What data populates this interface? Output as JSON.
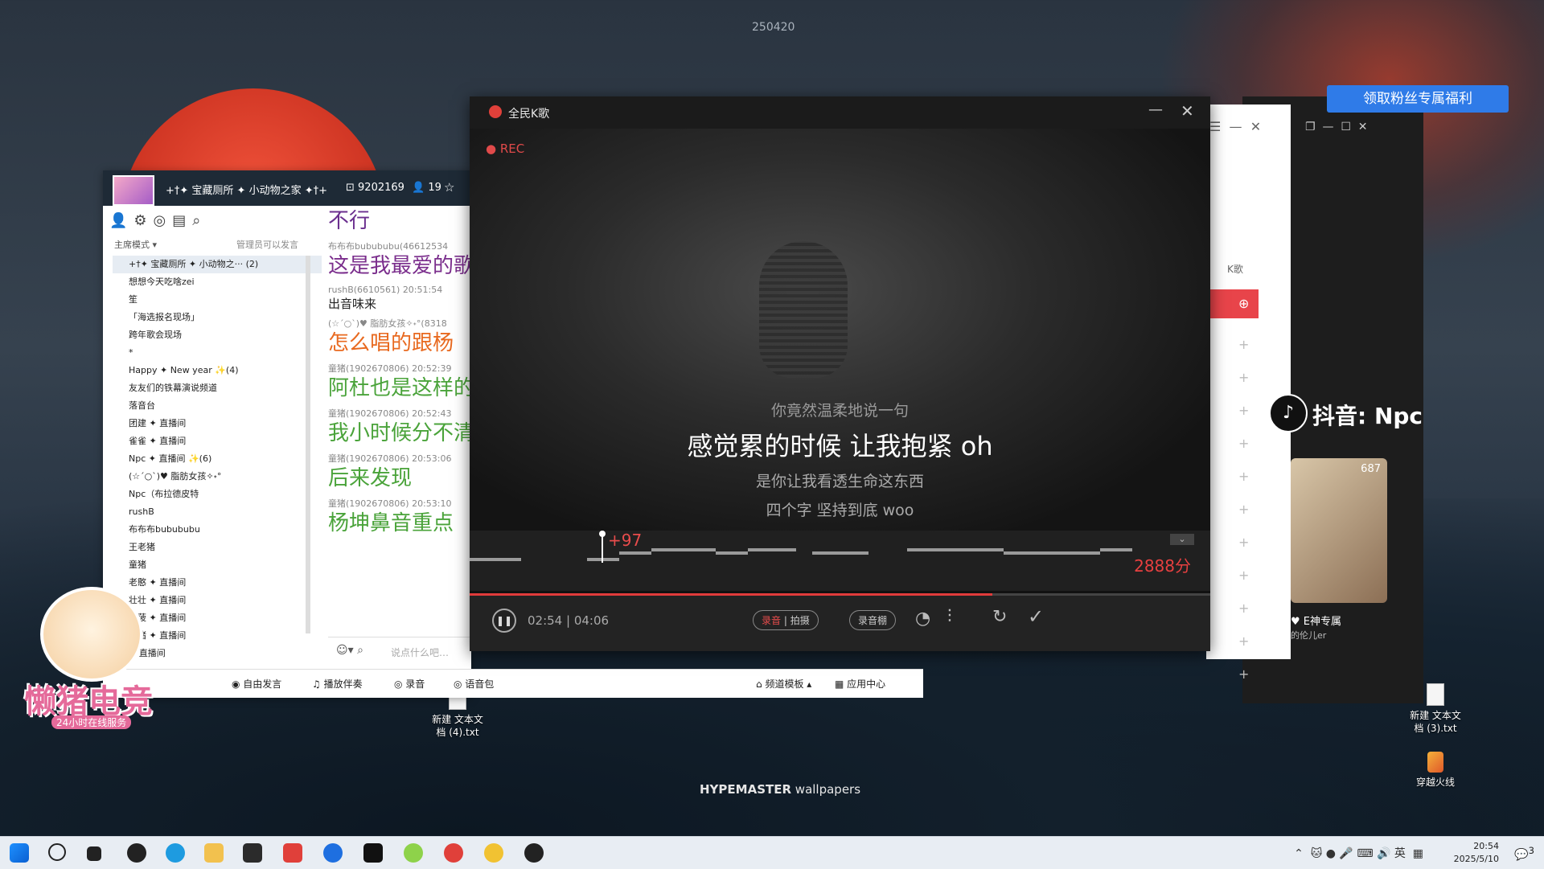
{
  "desktop": {
    "wallpaper_id": "250420",
    "wallpaper_brand_bold": "HYPEMASTER",
    "wallpaper_brand_rest": " wallpapers",
    "icons": [
      {
        "label": "新建 文本文\n档 (4).txt"
      },
      {
        "label": "新建 文本文\n档 (3).txt"
      },
      {
        "label": "穿越火线"
      }
    ],
    "badge_text": "懒猪电竞",
    "badge_sub": "24小时在线服务"
  },
  "yy": {
    "title": "+†✦ 宝藏厕所 ✦ 小动物之家 ✦†+",
    "channel_id": "9202169",
    "online_count": "19",
    "mode": "主席模式",
    "permission": "管理员可以发言",
    "tree": [
      {
        "text": "+†✦ 宝藏厕所 ✦ 小动物之···  (2)",
        "selected": true
      },
      {
        "text": "想想今天吃啥zei"
      },
      {
        "text": "笙"
      },
      {
        "text": "「海选报名现场」"
      },
      {
        "text": "跨年歌会现场"
      },
      {
        "text": "*"
      },
      {
        "text": "Happy ✦ New year ✨(4)"
      },
      {
        "text": "友友们的铁幕演说频道"
      },
      {
        "text": "落音台"
      },
      {
        "text": "团建 ✦ 直播间"
      },
      {
        "text": "雀雀 ✦ 直播间"
      },
      {
        "text": "Npc ✦ 直播间 ✨(6)"
      },
      {
        "text": "(☆´○`)♥ 脂肪女孩✧˖°"
      },
      {
        "text": "Npc（布拉德皮特"
      },
      {
        "text": "rushB"
      },
      {
        "text": "布布布bubububu"
      },
      {
        "text": "王老猪"
      },
      {
        "text": "童猪"
      },
      {
        "text": "老憨 ✦ 直播间"
      },
      {
        "text": "壮壮 ✦ 直播间"
      },
      {
        "text": "菠菠 ✦ 直播间"
      },
      {
        "text": "猪猪 ✦ 直播间"
      },
      {
        "text": "✦ 直播间"
      }
    ],
    "chat": [
      {
        "big": "不行",
        "color": "#6b2f8f"
      },
      {
        "meta": "布布布bubububu(46612534",
        "big": "这是我最爱的歌",
        "color": "#7a2d8c"
      },
      {
        "meta": "rushB(6610561) 20:51:54",
        "norm": "出音味来"
      },
      {
        "meta": "(☆´○`)♥ 脂肪女孩✧˖°(8318",
        "big": "怎么唱的跟杨",
        "color": "#e8691f"
      },
      {
        "meta": "童猪(1902670806) 20:52:39",
        "big": "阿杜也是这样的",
        "color": "#4aa33a"
      },
      {
        "meta": "童猪(1902670806) 20:52:43",
        "big": "我小时候分不清",
        "color": "#4aa33a"
      },
      {
        "meta": "童猪(1902670806) 20:53:06",
        "big": "后来发现",
        "color": "#4aa33a"
      },
      {
        "meta": "童猪(1902670806) 20:53:10",
        "big": "杨坤鼻音重点",
        "color": "#4aa33a"
      }
    ],
    "input_placeholder": "说点什么吧…",
    "bottom": [
      "自由发言",
      "播放伴奏",
      "录音",
      "语音包",
      "频道模板",
      "应用中心"
    ]
  },
  "ksong": {
    "title": "全民K歌",
    "rec": "REC",
    "lyrics": [
      "你竟然温柔地说一句",
      "感觉累的时候 让我抱紧 oh",
      "是你让我看透生命这东西",
      "四个字 坚持到底 woo"
    ],
    "score": "2888分",
    "plus": "+97",
    "time": "02:54 | 04:06",
    "progress": 0.706,
    "record_label": "录音",
    "camera_label": "拍摄",
    "booth_label": "录音棚",
    "list_header": "K歌"
  },
  "douyin": {
    "text": "抖音: Npc",
    "fan_button": "领取粉丝专属福利",
    "video_views": "687",
    "video_caption": "E神专属",
    "video_sub": "的伦儿er"
  },
  "taskbar": {
    "time": "20:54",
    "date": "2025/5/10",
    "ime": "英",
    "badge": "3"
  }
}
